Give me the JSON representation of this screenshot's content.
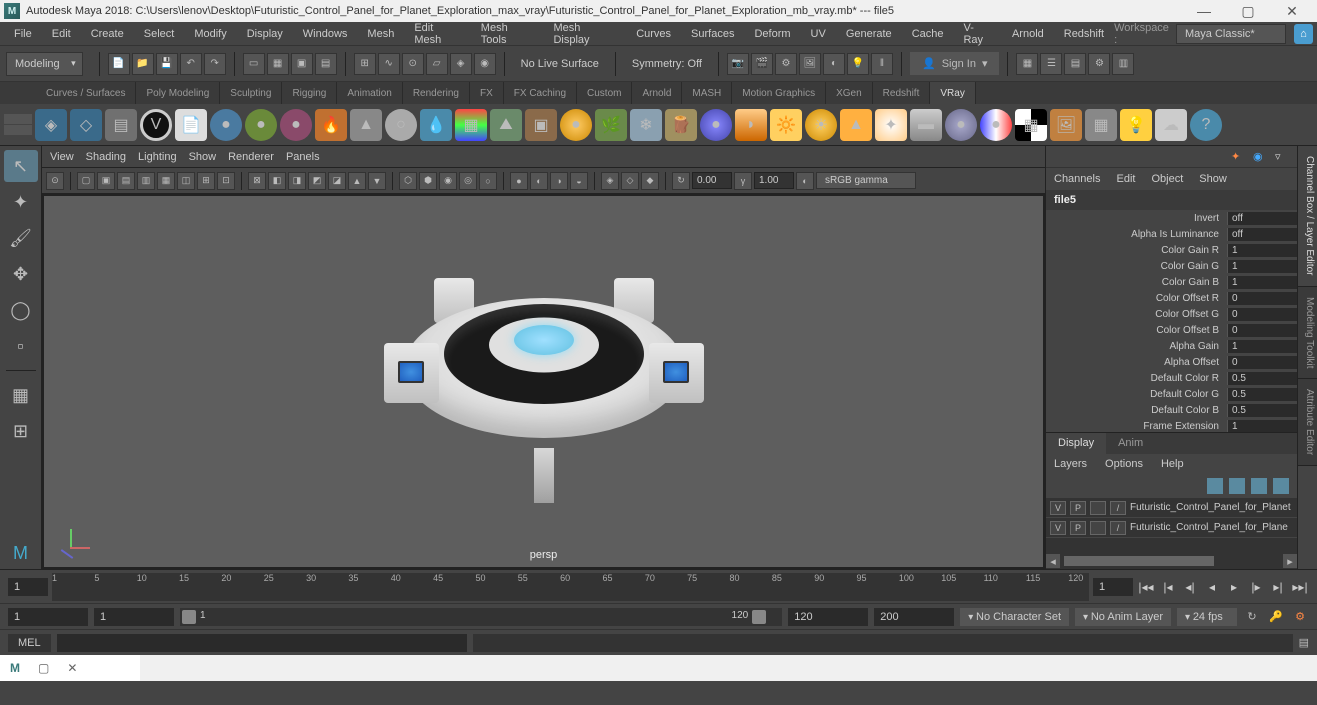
{
  "titlebar": {
    "logo_letter": "M",
    "title": "Autodesk Maya 2018: C:\\Users\\lenov\\Desktop\\Futuristic_Control_Panel_for_Planet_Exploration_max_vray\\Futuristic_Control_Panel_for_Planet_Exploration_mb_vray.mb*   ---   file5"
  },
  "menubar": {
    "items": [
      "File",
      "Edit",
      "Create",
      "Select",
      "Modify",
      "Display",
      "Windows",
      "Mesh",
      "Edit Mesh",
      "Mesh Tools",
      "Mesh Display",
      "Curves",
      "Surfaces",
      "Deform",
      "UV",
      "Generate",
      "Cache",
      "V-Ray",
      "Arnold",
      "Redshift"
    ],
    "workspace_label": "Workspace :",
    "workspace_value": "Maya Classic*"
  },
  "toolbar": {
    "mode": "Modeling",
    "live_surface": "No Live Surface",
    "symmetry": "Symmetry: Off",
    "signin": "Sign In"
  },
  "shelf_tabs": [
    "Curves / Surfaces",
    "Poly Modeling",
    "Sculpting",
    "Rigging",
    "Animation",
    "Rendering",
    "FX",
    "FX Caching",
    "Custom",
    "Arnold",
    "MASH",
    "Motion Graphics",
    "XGen",
    "Redshift",
    "VRay"
  ],
  "shelf_active": "VRay",
  "viewport_menu": [
    "View",
    "Shading",
    "Lighting",
    "Show",
    "Renderer",
    "Panels"
  ],
  "viewport": {
    "val1": "0.00",
    "val2": "1.00",
    "colorspace": "sRGB gamma",
    "camera": "persp"
  },
  "channel_box": {
    "menu": [
      "Channels",
      "Edit",
      "Object",
      "Show"
    ],
    "node": "file5",
    "attrs": [
      {
        "label": "Invert",
        "value": "off"
      },
      {
        "label": "Alpha Is Luminance",
        "value": "off"
      },
      {
        "label": "Color Gain R",
        "value": "1"
      },
      {
        "label": "Color Gain G",
        "value": "1"
      },
      {
        "label": "Color Gain B",
        "value": "1"
      },
      {
        "label": "Color Offset R",
        "value": "0"
      },
      {
        "label": "Color Offset G",
        "value": "0"
      },
      {
        "label": "Color Offset B",
        "value": "0"
      },
      {
        "label": "Alpha Gain",
        "value": "1"
      },
      {
        "label": "Alpha Offset",
        "value": "0"
      },
      {
        "label": "Default Color R",
        "value": "0.5"
      },
      {
        "label": "Default Color G",
        "value": "0.5"
      },
      {
        "label": "Default Color B",
        "value": "0.5"
      },
      {
        "label": "Frame Extension",
        "value": "1"
      }
    ]
  },
  "layer_editor": {
    "tabs": [
      "Display",
      "Anim"
    ],
    "menu": [
      "Layers",
      "Options",
      "Help"
    ],
    "layers": [
      {
        "v": "V",
        "p": "P",
        "name": "Futuristic_Control_Panel_for_Planet"
      },
      {
        "v": "V",
        "p": "P",
        "name": "Futuristic_Control_Panel_for_Plane"
      }
    ]
  },
  "vertical_tabs": [
    "Channel Box / Layer Editor",
    "Modeling Toolkit",
    "Attribute Editor"
  ],
  "timeline": {
    "start_frame": "1",
    "end_frame": "1",
    "ticks": [
      "1",
      "5",
      "10",
      "15",
      "20",
      "25",
      "30",
      "35",
      "40",
      "45",
      "50",
      "55",
      "60",
      "65",
      "70",
      "75",
      "80",
      "85",
      "90",
      "95",
      "100",
      "105",
      "110",
      "115",
      "120"
    ]
  },
  "range": {
    "start": "1",
    "range_start": "1",
    "range_end": "120",
    "play_end": "120",
    "end": "200",
    "charset": "No Character Set",
    "animlayer": "No Anim Layer",
    "fps": "24 fps"
  },
  "cmdline": {
    "lang": "MEL"
  }
}
